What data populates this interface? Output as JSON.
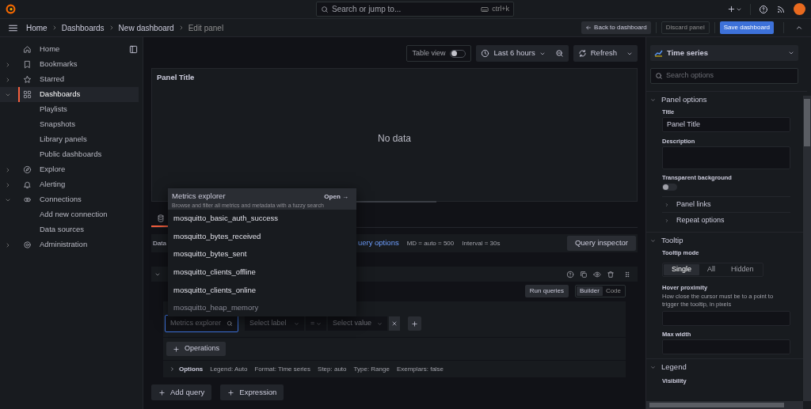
{
  "top_bar": {
    "search_placeholder": "Search or jump to...",
    "shortcut": "ctrl+k"
  },
  "breadcrumbs": [
    {
      "label": "Home",
      "selected": false
    },
    {
      "label": "Dashboards",
      "selected": false
    },
    {
      "label": "New dashboard",
      "selected": false
    },
    {
      "label": "Edit panel",
      "selected": true
    }
  ],
  "header_buttons": [
    {
      "label": "Back to dashboard",
      "kind": "back"
    },
    {
      "label": "Discard panel",
      "kind": "outline"
    },
    {
      "label": "Save dashboard",
      "kind": "primary"
    }
  ],
  "sidebar": {
    "items": [
      {
        "label": "Home",
        "selected": false
      },
      {
        "label": "Bookmarks",
        "selected": false,
        "expanded": false
      },
      {
        "label": "Starred",
        "selected": false,
        "expanded": false
      },
      {
        "label": "Dashboards",
        "selected": true,
        "expanded": true,
        "children": [
          {
            "label": "Playlists",
            "selected": false
          },
          {
            "label": "Snapshots",
            "selected": false
          },
          {
            "label": "Library panels",
            "selected": false
          },
          {
            "label": "Public dashboards",
            "selected": false
          }
        ]
      },
      {
        "label": "Explore",
        "selected": false,
        "expanded": false
      },
      {
        "label": "Alerting",
        "selected": false,
        "expanded": false
      },
      {
        "label": "Connections",
        "selected": false,
        "expanded": true,
        "children": [
          {
            "label": "Add new connection",
            "selected": false
          },
          {
            "label": "Data sources",
            "selected": false
          }
        ]
      },
      {
        "label": "Administration",
        "selected": false,
        "expanded": false
      }
    ]
  },
  "toolbar": {
    "table_view": {
      "label": "Table view",
      "on": false
    },
    "time_range": "Last 6 hours",
    "refresh": "Refresh"
  },
  "panel": {
    "title": "Panel Title",
    "message": "No data"
  },
  "query": {
    "data_label": "Data",
    "options_link": "uery options",
    "md": "MD = auto = 500",
    "interval": "Interval = 30s",
    "inspector": "Query inspector",
    "run": "Run queries",
    "modes": [
      {
        "label": "Builder",
        "selected": true
      },
      {
        "label": "Code",
        "selected": false
      }
    ],
    "metric_placeholder": "Metrics explorer",
    "label_placeholder": "Select label",
    "operator": "=",
    "value_placeholder": "Select value",
    "operations": "Operations",
    "options": {
      "title": "Options",
      "items": [
        "Legend: Auto",
        "Format: Time series",
        "Step: auto",
        "Type: Range",
        "Exemplars: false"
      ]
    }
  },
  "add_buttons": [
    "Add query",
    "Expression"
  ],
  "metrics_dropdown": {
    "title": "Metrics explorer",
    "description": "Browse and filter all metrics and metadata with a fuzzy search",
    "open": "Open →",
    "items": [
      "mosquitto_basic_auth_success",
      "mosquitto_bytes_received",
      "mosquitto_bytes_sent",
      "mosquitto_clients_offline",
      "mosquitto_clients_online",
      "mosquitto_heap_memory"
    ]
  },
  "options_pane": {
    "visualization": "Time series",
    "search_placeholder": "Search options",
    "sections": [
      {
        "title": "Panel options",
        "expanded": true,
        "items": [
          {
            "kind": "input",
            "label": "Title",
            "value": "Panel Title"
          },
          {
            "kind": "textarea",
            "label": "Description"
          },
          {
            "kind": "switch",
            "label": "Transparent background",
            "on": false
          },
          {
            "kind": "group",
            "label": "Panel links",
            "expanded": false
          },
          {
            "kind": "group",
            "label": "Repeat options",
            "expanded": false
          }
        ]
      },
      {
        "title": "Tooltip",
        "expanded": true,
        "items": [
          {
            "kind": "radio",
            "label": "Tooltip mode",
            "options": [
              {
                "label": "Single",
                "selected": true
              },
              {
                "label": "All",
                "selected": false
              },
              {
                "label": "Hidden",
                "selected": false
              }
            ]
          },
          {
            "kind": "input",
            "label": "Hover proximity",
            "description": "How close the cursor must be to a point to trigger the tooltip, in pixels"
          },
          {
            "kind": "input",
            "label": "Max width"
          }
        ]
      },
      {
        "title": "Legend",
        "expanded": true,
        "items": [
          {
            "kind": "heading",
            "label": "Visibility"
          }
        ]
      }
    ]
  }
}
